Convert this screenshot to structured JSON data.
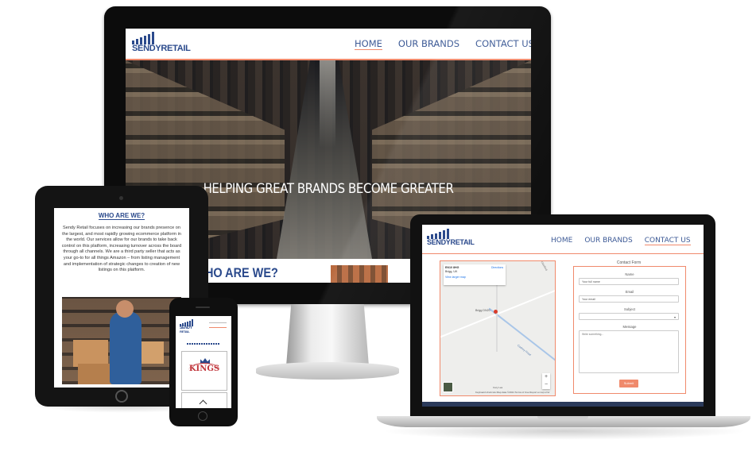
{
  "brand": {
    "name_part1": "SENDY",
    "name_part2": "RETAIL"
  },
  "desktop": {
    "nav": [
      {
        "label": "HOME",
        "active": true
      },
      {
        "label": "OUR BRANDS",
        "active": false
      },
      {
        "label": "CONTACT US",
        "active": false
      }
    ],
    "hero_headline": "HELPING GREAT BRANDS BECOME GREATER",
    "section_peek": "HO ARE WE?"
  },
  "tablet": {
    "heading": "WHO ARE WE?",
    "body": "Sendy Retail focuses on increasing our brands presence on the largest, and most rapidly growing ecommerce platform in the world. Our services allow for our brands to take back control on this platform, increasing turnover across the board through all channels. We are a third party seller that acts as your go-to for all things Amazon – from listing management and implementation of strategic changes to creation of new listings on this platform."
  },
  "phone": {
    "brand_card": "KINGS"
  },
  "laptop": {
    "nav": [
      {
        "label": "HOME",
        "active": false
      },
      {
        "label": "OUR BRANDS",
        "active": false
      },
      {
        "label": "CONTACT US",
        "active": true
      }
    ],
    "map": {
      "info_title": "EN10 8HG",
      "info_line": "Brigg, UK",
      "info_link": "View larger map",
      "directions": "Directions",
      "place_label": "Brigg DN20",
      "road_label": "Cadney Road",
      "road_label2": "Glanford",
      "zoom_in": "+",
      "zoom_out": "−",
      "footer": "Keyboard shortcuts   Map data ©2021   Terms of Use   Report a map error",
      "city": "Cary Lea"
    },
    "form": {
      "title": "Contact Form",
      "name_label": "Name",
      "name_placeholder": "Your full name",
      "email_label": "Email",
      "email_placeholder": "Your email",
      "subject_label": "Subject",
      "message_label": "Message",
      "message_placeholder": "Write something...",
      "submit_label": "Submit"
    }
  },
  "colors": {
    "brand_blue": "#2b4a8c",
    "accent_orange": "#f08a6c",
    "device_black": "#111111"
  }
}
